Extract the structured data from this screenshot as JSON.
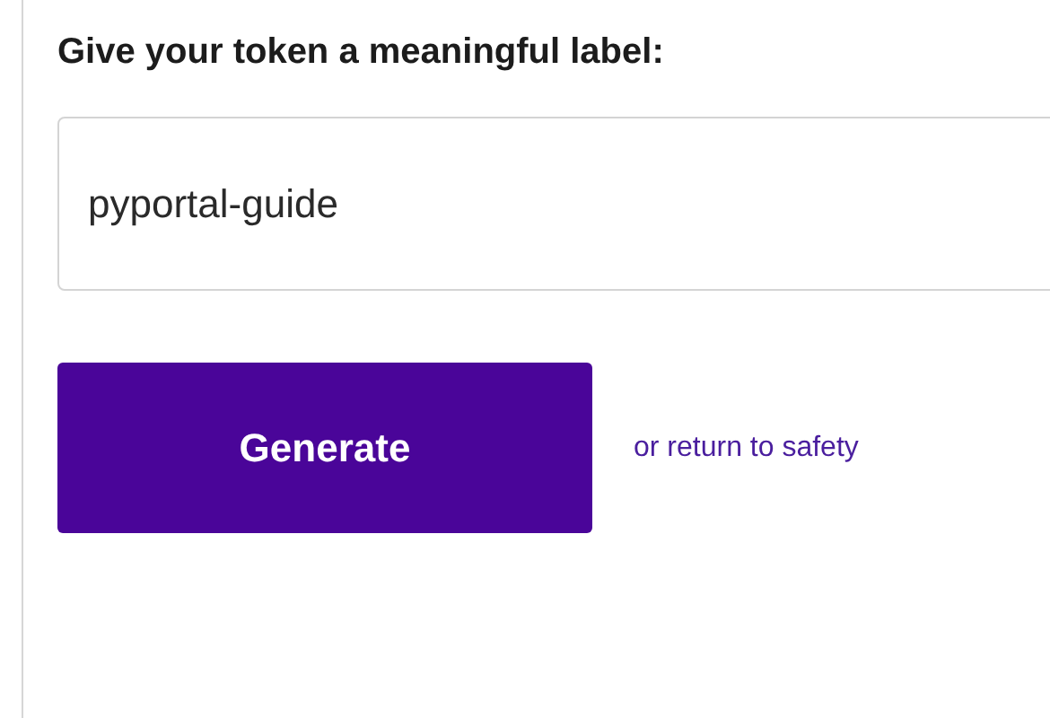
{
  "heading": "Give your token a meaningful label:",
  "label_field": {
    "value": "pyportal-guide"
  },
  "generate_button": {
    "label": "Generate"
  },
  "cancel_link": {
    "label": "or return to safety"
  }
}
